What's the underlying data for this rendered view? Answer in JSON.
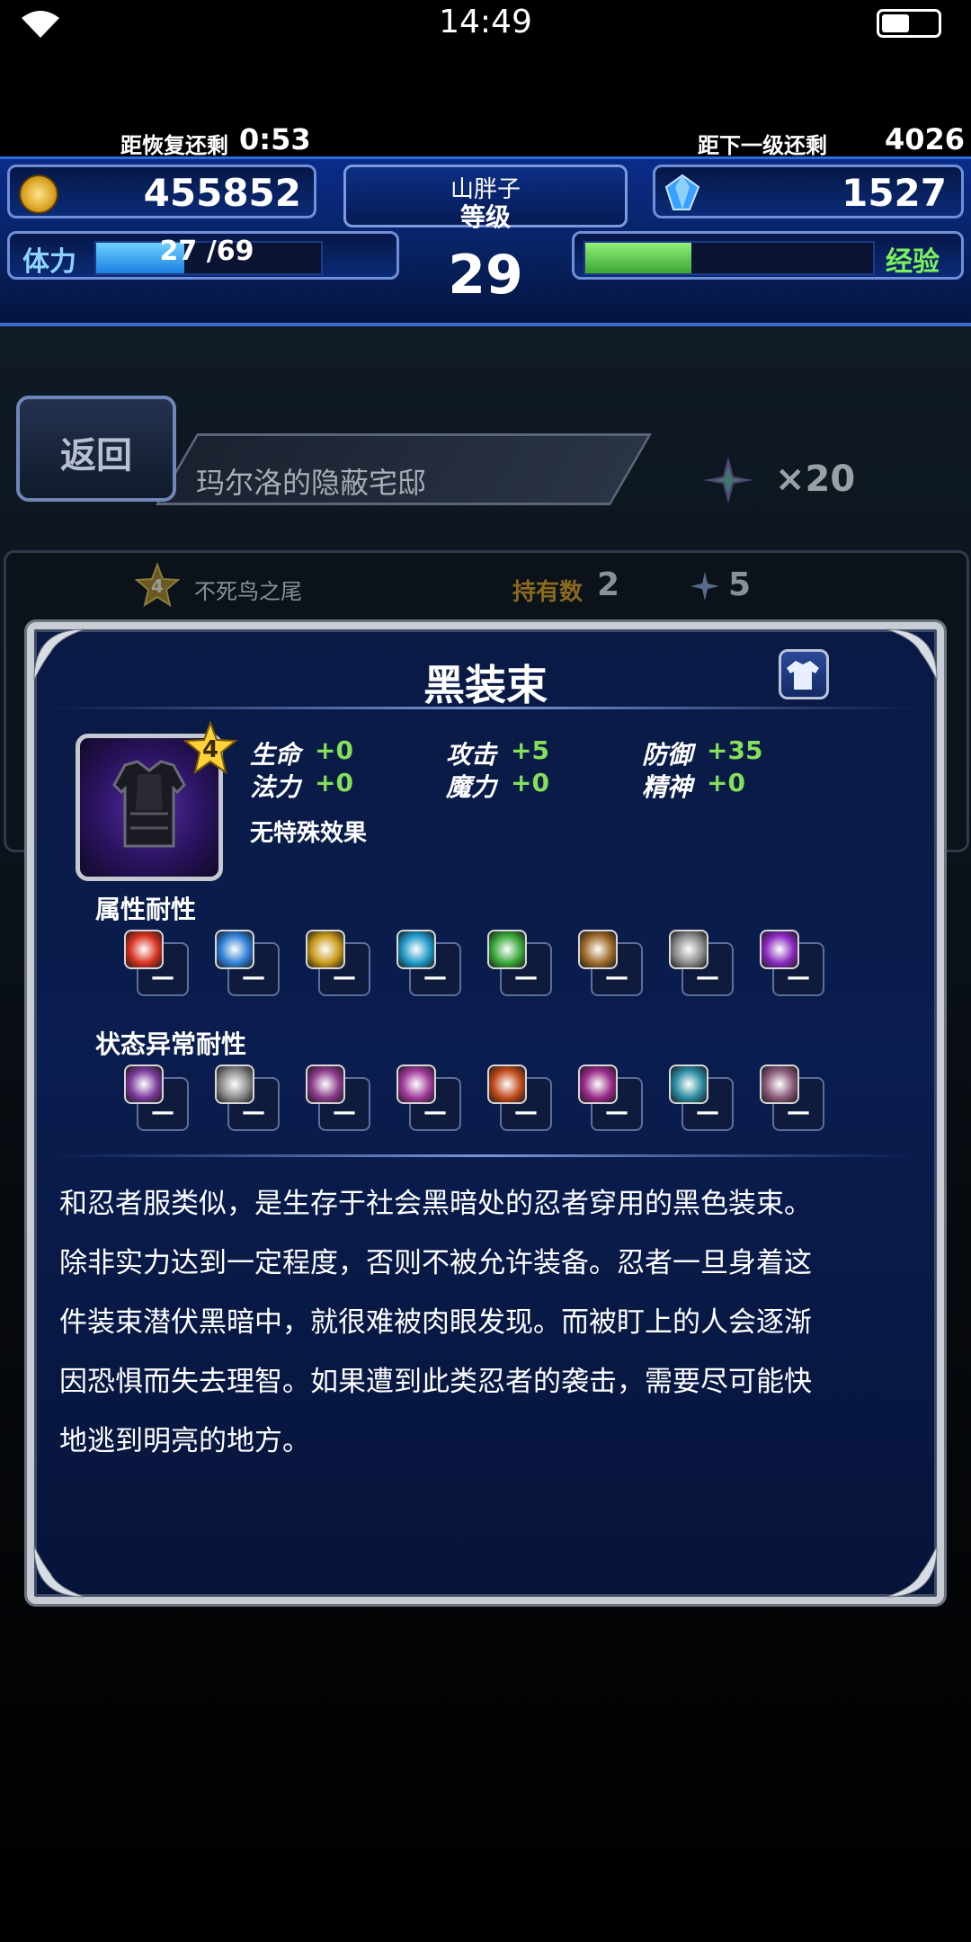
{
  "status_bar": {
    "time": "14:49"
  },
  "header": {
    "gil": "455852",
    "gems": "1527",
    "player_name": "山胖子",
    "level_label": "等级",
    "level": "29",
    "stamina_label": "体力",
    "stamina_text": "27 /69",
    "stamina_fraction": 0.39,
    "recover_label": "距恢复还剩",
    "recover_time": "0:53",
    "exp_label": "经验",
    "exp_fraction": 0.37,
    "next_label": "距下一级还剩",
    "next_value": "4026"
  },
  "nav": {
    "back_label": "返回",
    "location": "玛尔洛的隐蔽宅邸",
    "crystal_count": "×20"
  },
  "list": {
    "item_rarity": "4",
    "item_name": "不死鸟之尾",
    "owned_label": "持有数",
    "owned_value": "2",
    "crystal_value": "5"
  },
  "modal": {
    "title": "黑装束",
    "rarity": "4",
    "stats": [
      {
        "label": "生命",
        "value": "+0"
      },
      {
        "label": "攻击",
        "value": "+5"
      },
      {
        "label": "防御",
        "value": "+35"
      },
      {
        "label": "法力",
        "value": "+0"
      },
      {
        "label": "魔力",
        "value": "+0"
      },
      {
        "label": "精神",
        "value": "+0"
      }
    ],
    "special_effect": "无特殊效果",
    "element_resist_label": "属性耐性",
    "element_resists": [
      {
        "icon": "fire-icon",
        "value": "—",
        "color": "#d8321e"
      },
      {
        "icon": "ice-icon",
        "value": "—",
        "color": "#2f7fd6"
      },
      {
        "icon": "lightning-icon",
        "value": "—",
        "color": "#c89a1a"
      },
      {
        "icon": "water-icon",
        "value": "—",
        "color": "#1e98c8"
      },
      {
        "icon": "wind-icon",
        "value": "—",
        "color": "#3aa83a"
      },
      {
        "icon": "earth-icon",
        "value": "—",
        "color": "#a06a2a"
      },
      {
        "icon": "light-icon",
        "value": "—",
        "color": "#8c8c8c"
      },
      {
        "icon": "dark-icon",
        "value": "—",
        "color": "#8a2ac0"
      }
    ],
    "status_resist_label": "状态异常耐性",
    "status_resists": [
      {
        "icon": "poison-icon",
        "value": "—",
        "color": "#7a3a9a"
      },
      {
        "icon": "blind-icon",
        "value": "—",
        "color": "#8a8a8a"
      },
      {
        "icon": "sleep-icon",
        "value": "—",
        "color": "#8a3a8a"
      },
      {
        "icon": "silence-icon",
        "value": "—",
        "color": "#a03a9a"
      },
      {
        "icon": "paralysis-icon",
        "value": "—",
        "color": "#c04a1a"
      },
      {
        "icon": "confusion-icon",
        "value": "—",
        "color": "#9a2a8a"
      },
      {
        "icon": "disease-icon",
        "value": "—",
        "color": "#2a8aa0"
      },
      {
        "icon": "petrify-icon",
        "value": "—",
        "color": "#8a5a7a"
      }
    ],
    "description_lines": [
      "和忍者服类似，是生存于社会黑暗处的忍者穿用的黑色装束。",
      "除非实力达到一定程度，否则不被允许装备。忍者一旦身着这",
      "件装束潜伏黑暗中，就很难被肉眼发现。而被盯上的人会逐渐",
      "因恐惧而失去理智。如果遭到此类忍者的袭击，需要尽可能快",
      "地逃到明亮的地方。"
    ]
  }
}
